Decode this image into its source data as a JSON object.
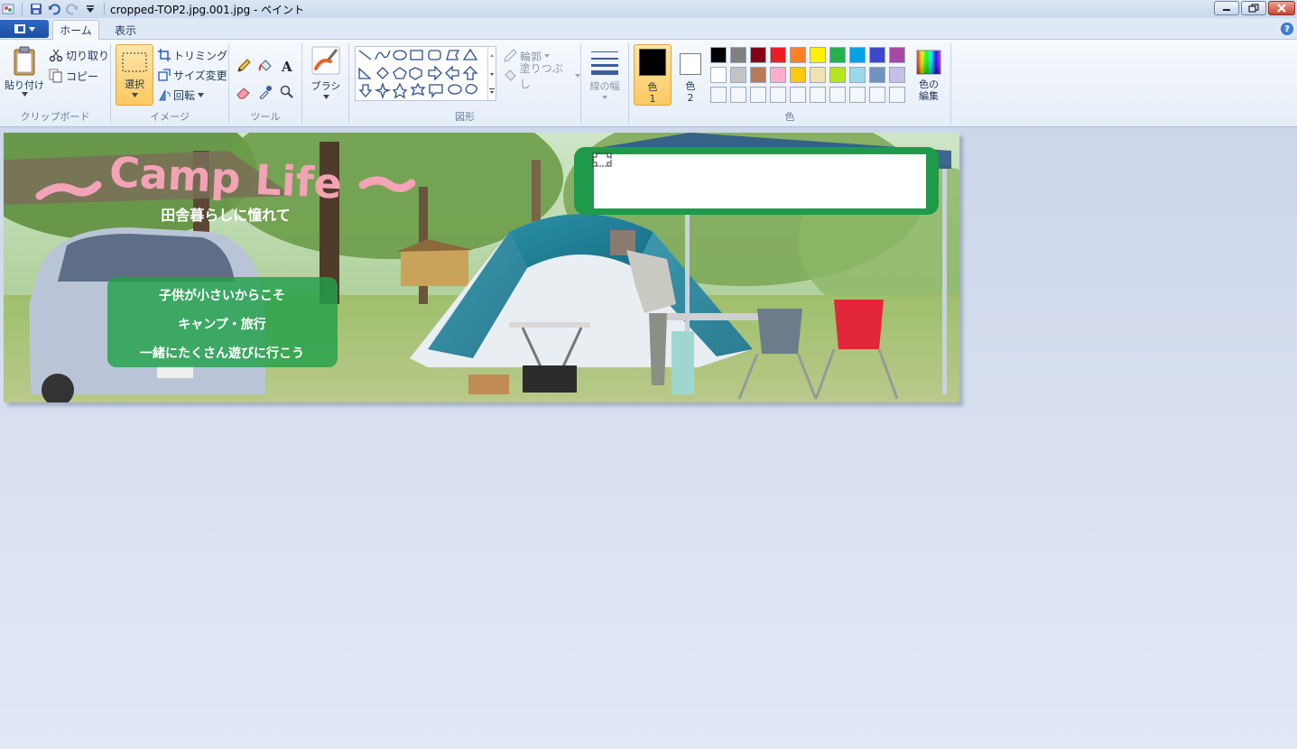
{
  "window": {
    "title": "cropped-TOP2.jpg.001.jpg - ペイント",
    "qat": [
      "paint-app-icon",
      "save-icon",
      "undo-icon",
      "redo-icon",
      "customize-dropdown-icon"
    ],
    "controls": {
      "minimize": "▭",
      "restore": "▣",
      "close": "✕"
    }
  },
  "tabs": [
    {
      "label": "ホーム",
      "active": true
    },
    {
      "label": "表示",
      "active": false
    }
  ],
  "ribbon": {
    "clipboard": {
      "label": "クリップボード",
      "paste": "貼り付け",
      "cut": "切り取り",
      "copy": "コピー"
    },
    "image": {
      "label": "イメージ",
      "select": "選択",
      "crop": "トリミング",
      "resize": "サイズ変更",
      "rotate": "回転"
    },
    "tools": {
      "label": "ツール"
    },
    "brushes": {
      "label": "ブラシ"
    },
    "shapes": {
      "label": "図形",
      "outline": "輪郭",
      "fill": "塗りつぶし"
    },
    "size": {
      "label": "線の幅"
    },
    "colors": {
      "label": "色",
      "color1": "色\n1",
      "color1_a": "色",
      "color1_b": "1",
      "color2_a": "色",
      "color2_b": "2",
      "edit_a": "色の",
      "edit_b": "編集",
      "color1_value": "#000000",
      "color2_value": "#ffffff",
      "palette_row1": [
        "#000000",
        "#7f7f7f",
        "#880015",
        "#ed1c24",
        "#ff7f27",
        "#fff200",
        "#22b14c",
        "#00a2e8",
        "#3f48cc",
        "#a349a4"
      ],
      "palette_row2": [
        "#ffffff",
        "#c3c3c3",
        "#b97a57",
        "#ffaec9",
        "#ffc90e",
        "#efe4b0",
        "#b5e61d",
        "#99d9ea",
        "#7092be",
        "#c8bfe7"
      ]
    }
  },
  "canvas": {
    "banner_title": "～Camp Life～",
    "banner_subtitle": "田舎暮らしに憧れて",
    "box_line1": "子供が小さいからこそ",
    "box_line2": "キャンプ・旅行",
    "box_line3": "一緒にたくさん遊びに行こう"
  }
}
